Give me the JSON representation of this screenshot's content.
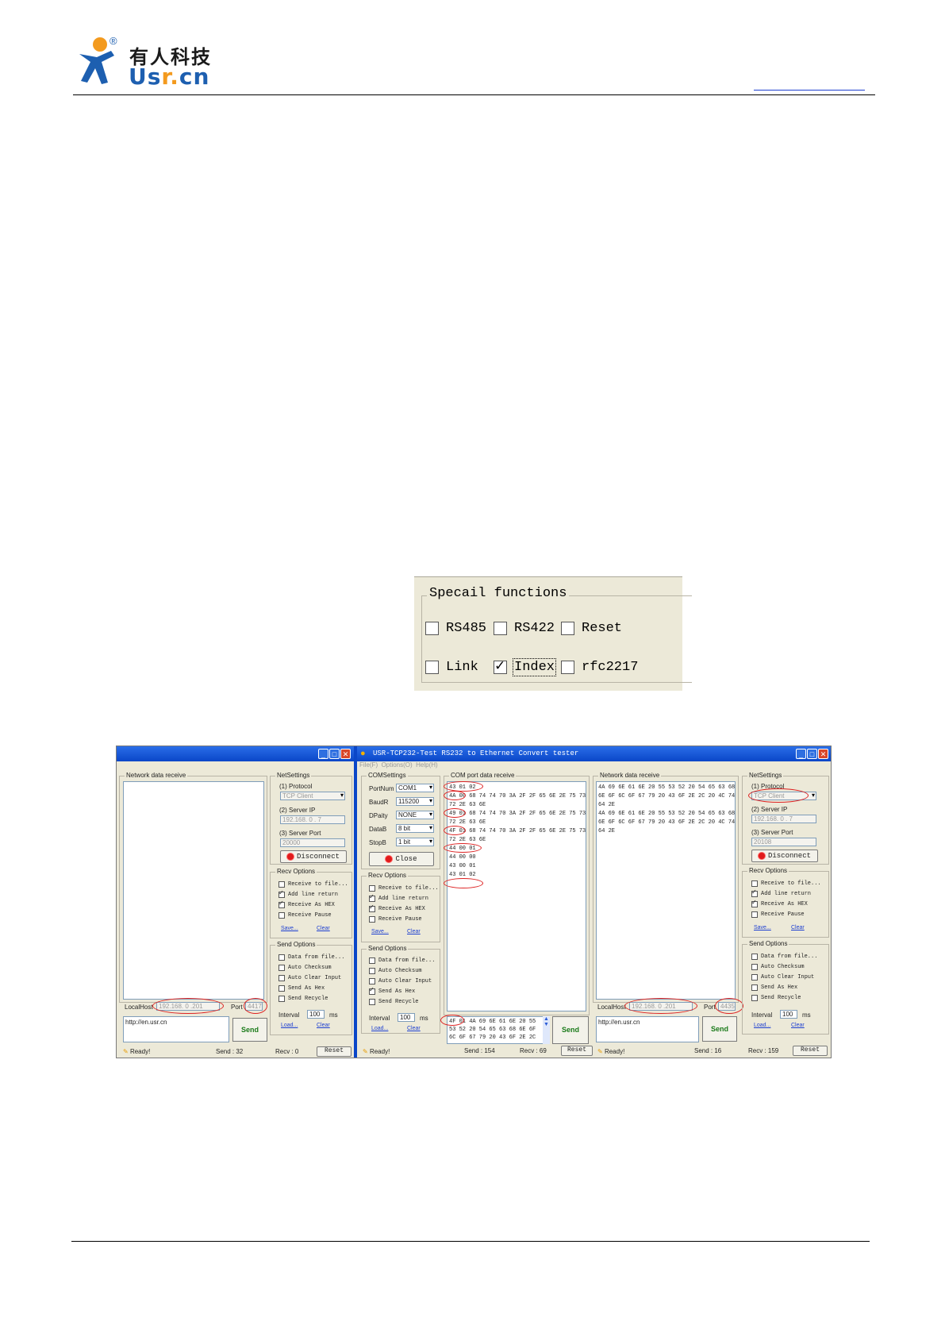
{
  "header": {
    "brand_cn": "有人科技",
    "brand_en_prefix": "Us",
    "brand_en_mid": "r",
    "brand_en_dot": ".",
    "brand_en_suffix": "cn",
    "registered_mark": "®",
    "accent_blue": "#1d5fb0",
    "accent_orange": "#f39a1e"
  },
  "special_functions": {
    "title": "Specail functions",
    "options": [
      {
        "label": "RS485",
        "checked": false
      },
      {
        "label": "RS422",
        "checked": false
      },
      {
        "label": "Reset",
        "checked": false
      },
      {
        "label": "Link",
        "checked": false
      },
      {
        "label": "Index",
        "checked": true
      },
      {
        "label": "rfc2217",
        "checked": false
      }
    ]
  },
  "tester": {
    "title": "USR-TCP232-Test  RS232 to Ethernet Convert tester",
    "menu": [
      "File(F)",
      "Options(O)",
      "Help(H)"
    ],
    "left": {
      "network_receive_title": "Network data receive",
      "netsettings_title": "NetSettings",
      "protocol_label": "(1) Protocol",
      "protocol_value": "TCP Client",
      "server_ip_label": "(2) Server IP",
      "server_ip_value": "192.168. 0 . 7",
      "server_port_label": "(3) Server Port",
      "server_port_value": "20000",
      "disconnect": "Disconnect",
      "recv_options_title": "Recv Options",
      "recv_options": [
        {
          "label": "Receive to file...",
          "checked": false
        },
        {
          "label": "Add line return",
          "checked": true
        },
        {
          "label": "Receive As HEX",
          "checked": true
        },
        {
          "label": "Receive Pause",
          "checked": false
        }
      ],
      "save": "Save...",
      "clear": "Clear",
      "send_options_title": "Send Options",
      "send_options": [
        {
          "label": "Data from file...",
          "checked": false
        },
        {
          "label": "Auto Checksum",
          "checked": false
        },
        {
          "label": "Auto Clear Input",
          "checked": false
        },
        {
          "label": "Send As Hex",
          "checked": false
        },
        {
          "label": "Send Recycle",
          "checked": false
        }
      ],
      "interval_label": "Interval",
      "interval_value": "100",
      "interval_unit": "ms",
      "load": "Load...",
      "clear2": "Clear",
      "localhost_label": "LocalHost",
      "localhost_value": "192.168. 0 .201",
      "port_label": "Port",
      "port_value": "4417",
      "send_input": "http://en.usr.cn",
      "send_button": "Send",
      "status_ready": "Ready!",
      "status_send": "Send : 32",
      "status_recv": "Recv : 0",
      "reset": "Reset"
    },
    "middle": {
      "com_settings_title": "COMSettings",
      "port_label": "PortNum",
      "port_value": "COM1",
      "baud_label": "BaudR",
      "baud_value": "115200",
      "parity_label": "DPaity",
      "parity_value": "NONE",
      "databits_label": "DataB",
      "databits_value": "8 bit",
      "stopbits_label": "StopB",
      "stopbits_value": "1 bit",
      "close_button": "Close",
      "com_receive_title": "COM port data receive",
      "com_receive_lines": [
        "43 01 02",
        "4A 00 68 74 74 70 3A 2F 2F 65 6E 2E 75 73",
        "72 2E 63 6E",
        "49 01 68 74 74 70 3A 2F 2F 65 6E 2E 75 73",
        "72 2E 63 6E",
        "4F 01 68 74 74 70 3A 2F 2F 65 6E 2E 75 73",
        "72 2E 63 6E",
        "44 00 01",
        "44 00 00",
        "43 00 01",
        "43 01 02"
      ],
      "recv_options_title": "Recv Options",
      "recv_options": [
        {
          "label": "Receive to file...",
          "checked": false
        },
        {
          "label": "Add line return",
          "checked": true
        },
        {
          "label": "Receive As HEX",
          "checked": true
        },
        {
          "label": "Receive Pause",
          "checked": false
        }
      ],
      "save": "Save...",
      "clear": "Clear",
      "send_options_title": "Send Options",
      "send_options": [
        {
          "label": "Data from file...",
          "checked": false
        },
        {
          "label": "Auto Checksum",
          "checked": false
        },
        {
          "label": "Auto Clear Input",
          "checked": false
        },
        {
          "label": "Send As Hex",
          "checked": true
        },
        {
          "label": "Send Recycle",
          "checked": false
        }
      ],
      "interval_label": "Interval",
      "interval_value": "100",
      "interval_unit": "ms",
      "load": "Load...",
      "clear2": "Clear",
      "send_lines": [
        "4F 01 4A 69 6E 61 6E 20 55",
        "53 52 20 54 65 63 68 6E 6F",
        "6C 6F 67 79 20 43 6F 2E 2C"
      ],
      "send_button": "Send",
      "status_ready": "Ready!",
      "status_send": "Send : 154",
      "status_recv": "Recv : 69",
      "reset": "Reset"
    },
    "right": {
      "network_receive_title": "Network data receive",
      "network_receive_lines": [
        "4A 69 6E 61 6E 20 55 53 52 20 54 65 63 68",
        "6E 6F 6C 6F 67 79 20 43 6F 2E 2C 20 4C 74",
        "64 2E",
        "4A 69 6E 61 6E 20 55 53 52 20 54 65 63 68",
        "6E 6F 6C 6F 67 79 20 43 6F 2E 2C 20 4C 74",
        "64 2E"
      ],
      "netsettings_title": "NetSettings",
      "protocol_label": "(1) Protocol",
      "protocol_value": "TCP Client",
      "server_ip_label": "(2) Server IP",
      "server_ip_value": "192.168. 0 . 7",
      "server_port_label": "(3) Server Port",
      "server_port_value": "20108",
      "disconnect": "Disconnect",
      "recv_options_title": "Recv Options",
      "recv_options": [
        {
          "label": "Receive to file...",
          "checked": false
        },
        {
          "label": "Add line return",
          "checked": true
        },
        {
          "label": "Receive As HEX",
          "checked": true
        },
        {
          "label": "Receive Pause",
          "checked": false
        }
      ],
      "save": "Save...",
      "clear": "Clear",
      "send_options_title": "Send Options",
      "send_options": [
        {
          "label": "Data from file...",
          "checked": false
        },
        {
          "label": "Auto Checksum",
          "checked": false
        },
        {
          "label": "Auto Clear Input",
          "checked": false
        },
        {
          "label": "Send As Hex",
          "checked": false
        },
        {
          "label": "Send Recycle",
          "checked": false
        }
      ],
      "interval_label": "Interval",
      "interval_value": "100",
      "interval_unit": "ms",
      "load": "Load...",
      "clear2": "Clear",
      "localhost_label": "LocalHost",
      "localhost_value": "192.168. 0 .201",
      "port_label": "Port",
      "port_value": "4435",
      "send_input": "http://en.usr.cn",
      "send_button": "Send",
      "status_ready": "Ready!",
      "status_send": "Send : 16",
      "status_recv": "Recv : 159",
      "reset": "Reset"
    }
  }
}
